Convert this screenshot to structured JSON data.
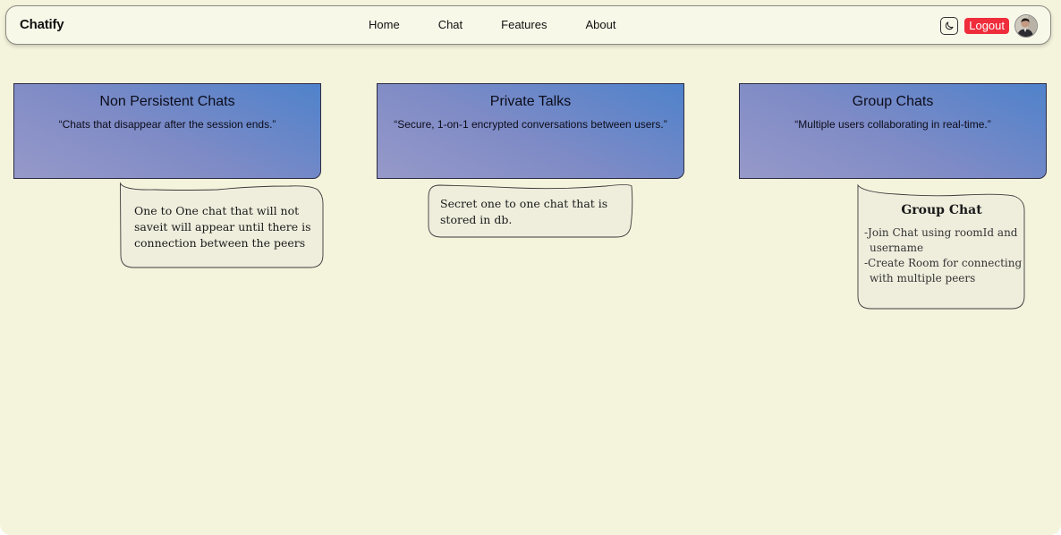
{
  "navbar": {
    "brand": "Chatify",
    "links": [
      "Home",
      "Chat",
      "Features",
      "About"
    ],
    "logout_label": "Logout",
    "theme_icon": "moon-icon"
  },
  "cards": [
    {
      "title": "Non Persistent Chats",
      "description": "“Chats that disappear after the session ends.”"
    },
    {
      "title": "Private Talks",
      "description": "“Secure, 1-on-1 encrypted conversations between users.”"
    },
    {
      "title": "Group Chats",
      "description": "“Multiple users collaborating in real-time.”"
    }
  ],
  "bubbles": {
    "non_persistent": {
      "lines": [
        "One to One chat that will not",
        "saveit will appear until there is",
        "connection between the peers"
      ]
    },
    "private": {
      "lines": [
        "Secret one to one chat that is",
        "stored in db."
      ]
    },
    "group": {
      "title": "Group Chat",
      "lines": [
        "-Join Chat using roomId and",
        "username",
        "-Create Room for connecting",
        "with multiple peers"
      ]
    }
  },
  "colors": {
    "page_background": "#f4f3dc",
    "navbar_background": "#f8f8e9",
    "logout_red": "#ef2d3b",
    "card_gradient_start": "#9699c9",
    "card_gradient_end": "#4f82cb",
    "bubble_fill": "#efeedd"
  }
}
